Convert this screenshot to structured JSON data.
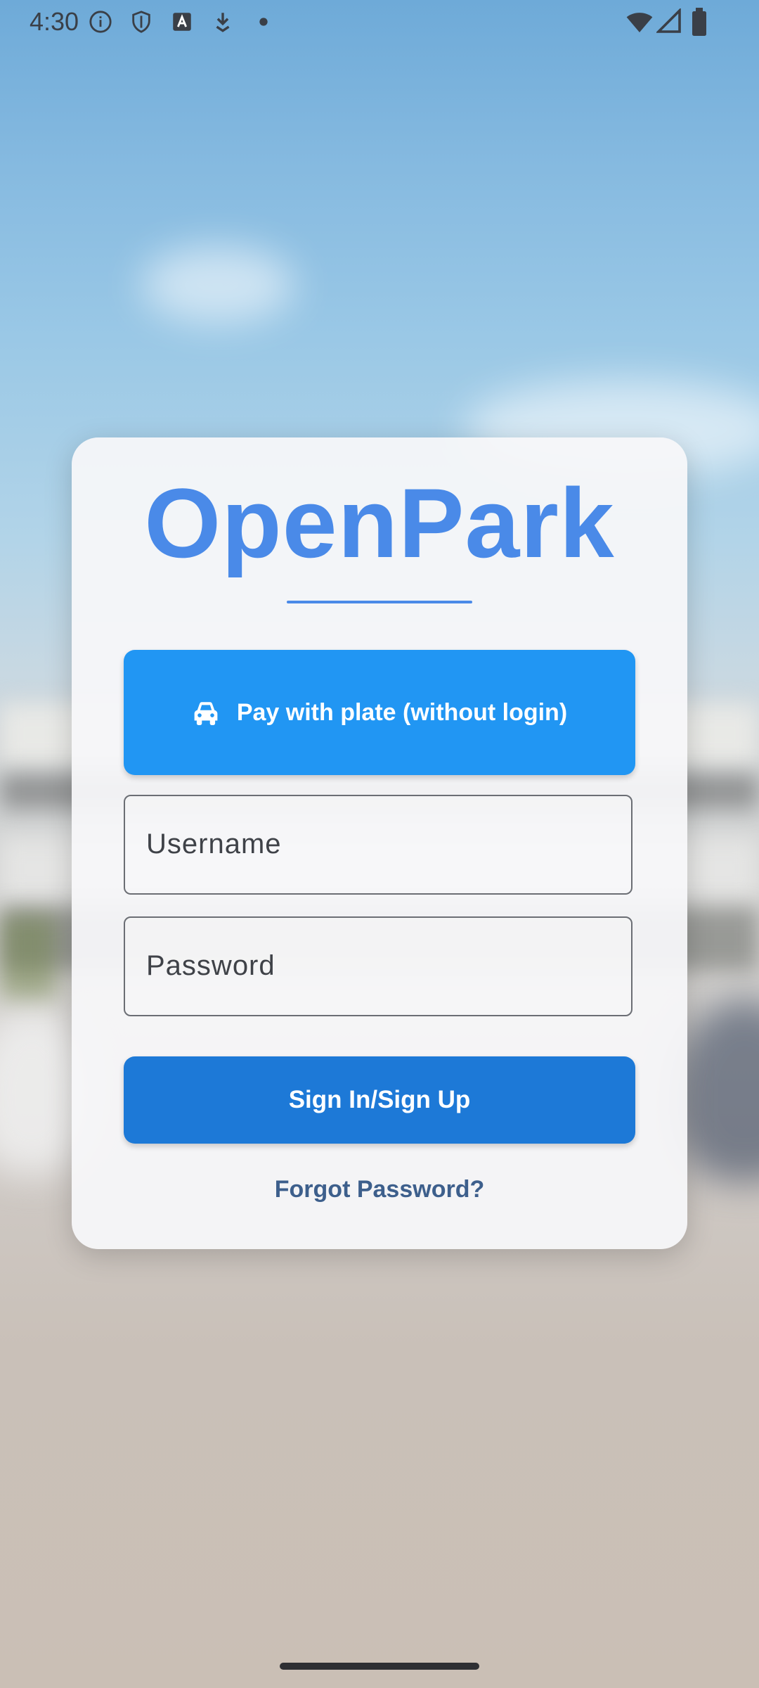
{
  "status_bar": {
    "time": "4:30",
    "icons": [
      "info-icon",
      "shield-icon",
      "a-icon",
      "download-icon",
      "dot-icon",
      "wifi-icon",
      "signal-icon",
      "battery-icon"
    ]
  },
  "login": {
    "app_title": "OpenPark",
    "plate_button_label": "Pay with plate (without login)",
    "plate_button_icon": "car-icon",
    "username_placeholder": "Username",
    "password_placeholder": "Password",
    "signin_button_label": "Sign In/Sign Up",
    "forgot_password_label": "Forgot Password?"
  },
  "colors": {
    "brand": "#4a8ae8",
    "plate_button": "#2196f3",
    "signin_button": "#1d79d7",
    "link": "#3d5f8c"
  }
}
